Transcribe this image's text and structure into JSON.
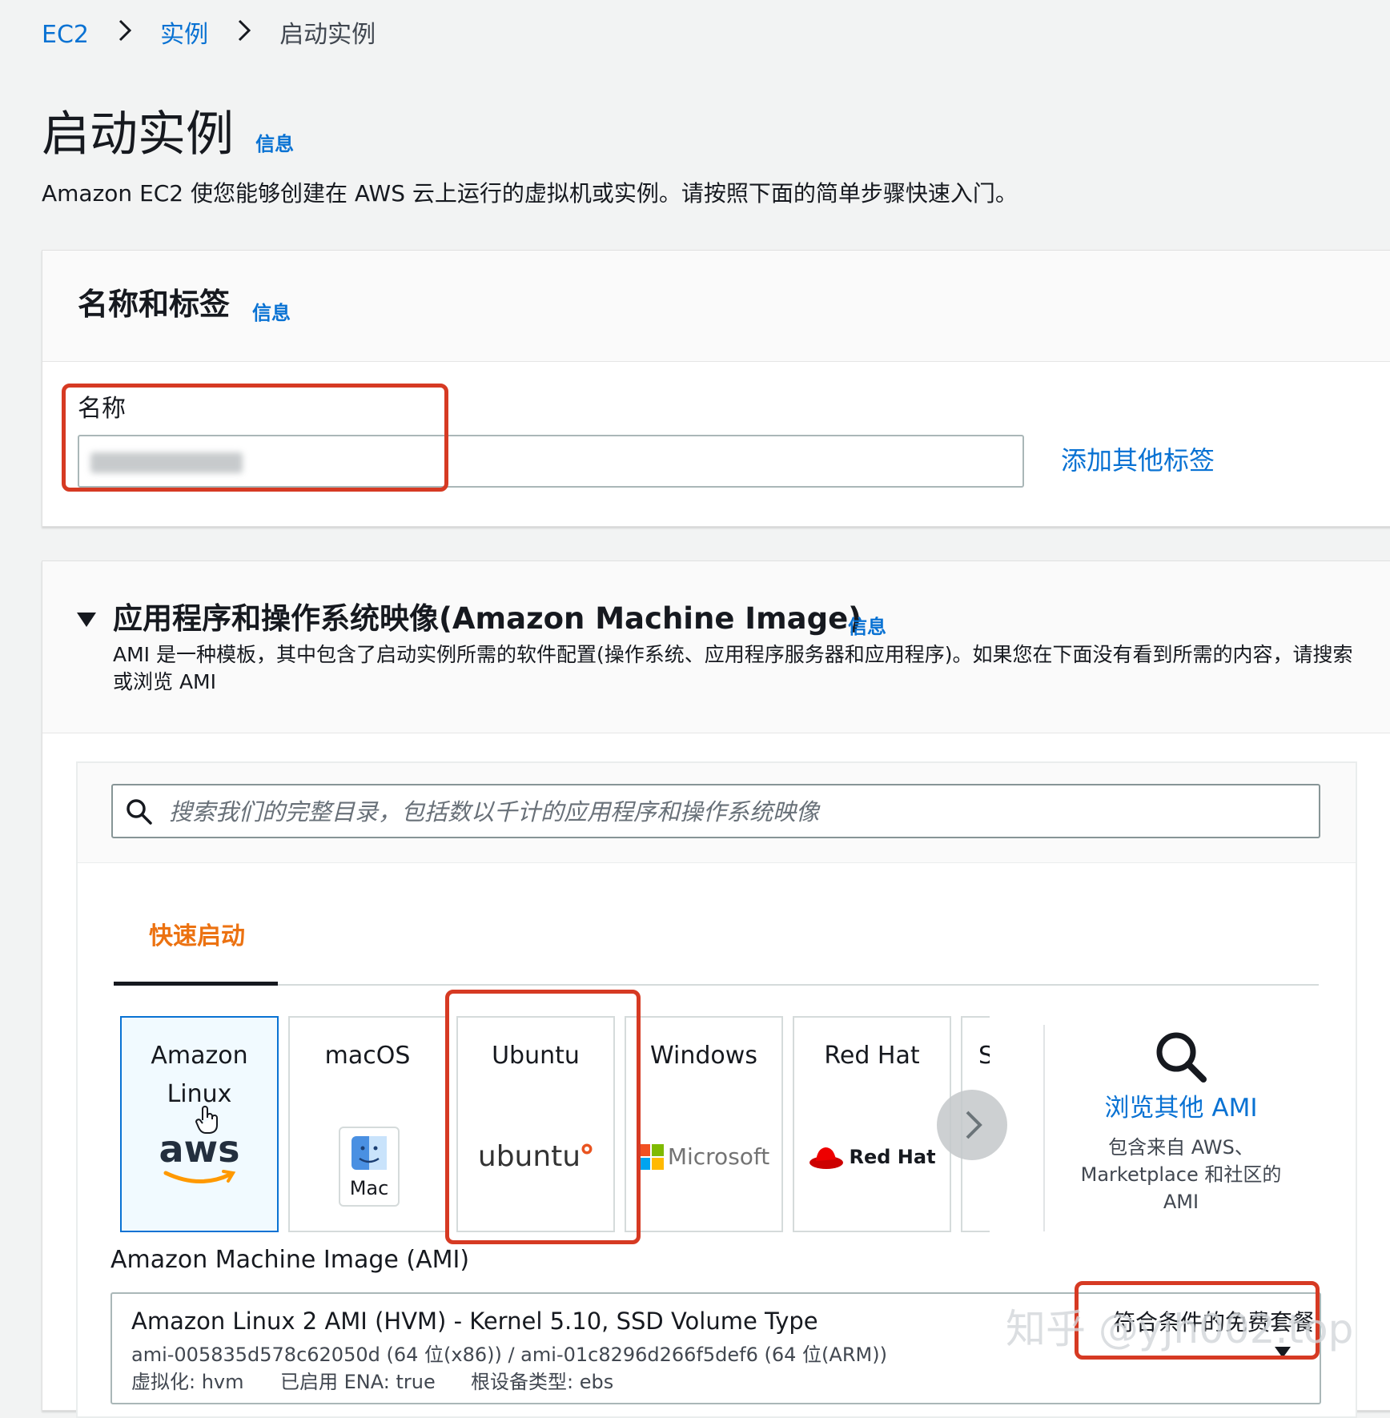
{
  "breadcrumb": {
    "items": [
      "EC2",
      "实例"
    ],
    "current": "启动实例"
  },
  "page": {
    "title": "启动实例",
    "info": "信息",
    "description": "Amazon EC2 使您能够创建在 AWS 云上运行的虚拟机或实例。请按照下面的简单步骤快速入门。"
  },
  "name_tags": {
    "title": "名称和标签",
    "info": "信息",
    "name_label": "名称",
    "add_tags": "添加其他标签"
  },
  "ami": {
    "title": "应用程序和操作系统映像(Amazon Machine Image)",
    "info": "信息",
    "description": "AMI 是一种模板，其中包含了启动实例所需的软件配置(操作系统、应用程序服务器和应用程序)。如果您在下面没有看到所需的内容，请搜索或浏览 AMI",
    "search_placeholder": "搜索我们的完整目录，包括数以千计的应用程序和操作系统映像",
    "tab_quick_start": "快速启动",
    "cards": {
      "amazon_linux": {
        "title": "Amazon Linux",
        "logo": "aws"
      },
      "macos": {
        "title": "macOS",
        "logo": "Mac"
      },
      "ubuntu": {
        "title": "Ubuntu",
        "logo": "ubuntu"
      },
      "windows": {
        "title": "Windows",
        "logo": "Microsoft"
      },
      "redhat": {
        "title": "Red Hat",
        "logo": "Red Hat"
      },
      "partial": {
        "title": "S"
      }
    },
    "browse": {
      "title": "浏览其他 AMI",
      "desc_line1": "包含来自 AWS、",
      "desc_line2": "Marketplace 和社区的",
      "desc_line3": "AMI"
    },
    "ami_label": "Amazon Machine Image (AMI)",
    "selected": {
      "name": "Amazon Linux 2 AMI (HVM) - Kernel 5.10, SSD Volume Type",
      "ids": "ami-005835d578c62050d (64 位(x86)) / ami-01c8296d266f5def6 (64 位(ARM))",
      "virt": "虚拟化: hvm",
      "ena": "已启用 ENA: true",
      "root": "根设备类型: ebs",
      "free_tier": "符合条件的免费套餐"
    }
  },
  "watermark": "知乎 @yjh002.top",
  "colors": {
    "link": "#0972d3",
    "tab_active": "#ec7211",
    "highlight": "#d63a23",
    "selected_card_bg": "#f1faff"
  }
}
